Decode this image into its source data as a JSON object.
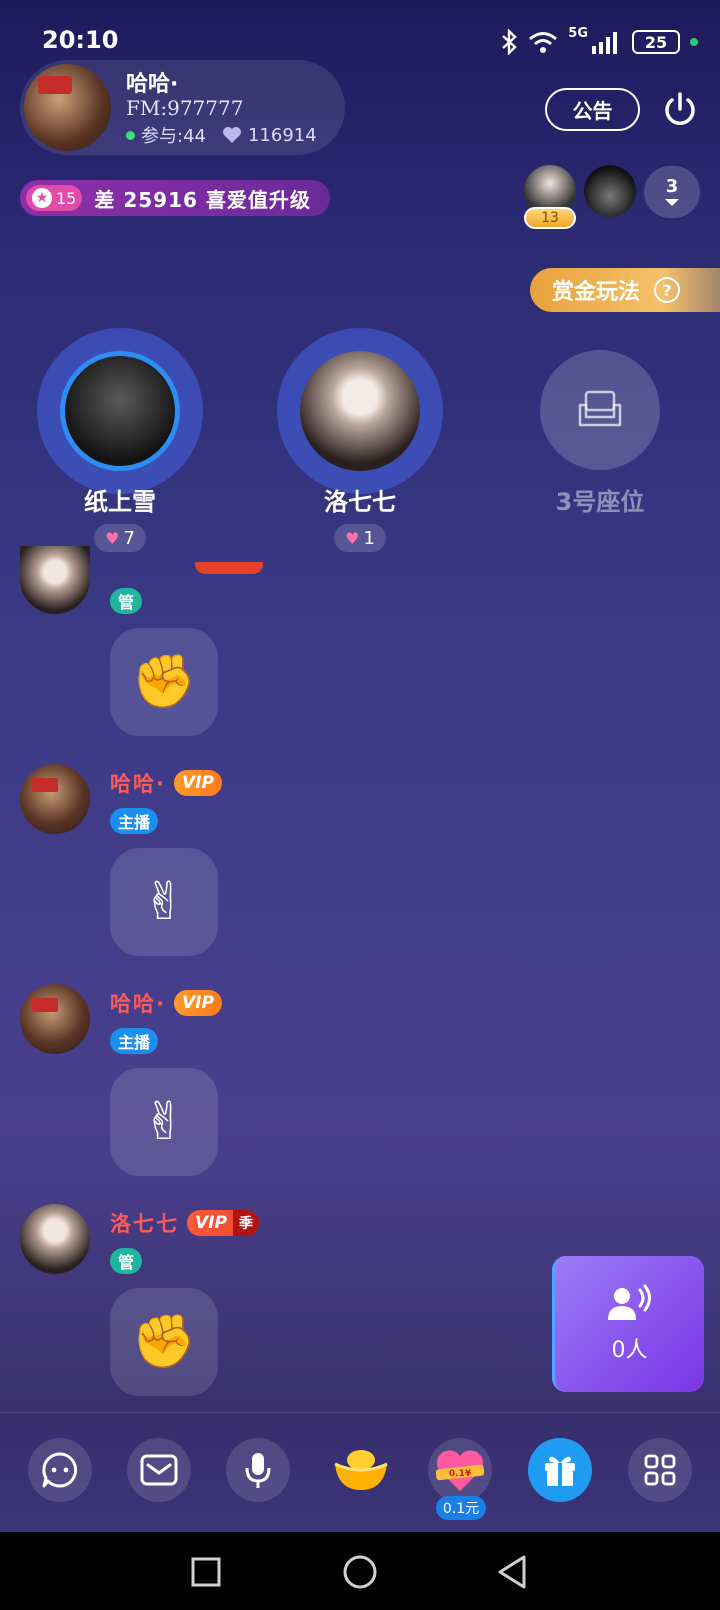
{
  "status_bar": {
    "time": "20:10",
    "network": "5G",
    "battery": "25"
  },
  "host": {
    "name": "哈哈·",
    "fm": "FM:977777",
    "participants": "参与:44",
    "likes": "116914"
  },
  "notice_label": "公告",
  "level": {
    "badge": "15",
    "text": "差 25916 喜爱值升级"
  },
  "audience": {
    "badge": "13",
    "count": "3"
  },
  "bounty_label": "赏金玩法",
  "seats": [
    {
      "name": "纸上雪",
      "hearts": "7"
    },
    {
      "name": "洛七七",
      "hearts": "1"
    },
    {
      "name": "3号座位"
    }
  ],
  "chat": [
    {
      "name": "",
      "vip": "",
      "role": "管",
      "emoji": "✊"
    },
    {
      "name": "哈哈·",
      "vip": "VIP",
      "role": "主播",
      "emoji": "✌"
    },
    {
      "name": "哈哈·",
      "vip": "VIP",
      "role": "主播",
      "emoji": "✌"
    },
    {
      "name": "洛七七",
      "vip": "VIP",
      "season": "季",
      "role": "管",
      "emoji": "✊"
    }
  ],
  "mic_queue": {
    "label": "0人"
  },
  "bottom_bar": {
    "gift_price": "0.1元",
    "heart_label": "0.1¥"
  },
  "colors": {
    "accent_blue": "#1f9bf2",
    "name_red": "#ff5a5a",
    "vip_orange": "#ff8a22",
    "admin_teal": "#1fb59e",
    "host_blue": "#1a8ff0"
  }
}
